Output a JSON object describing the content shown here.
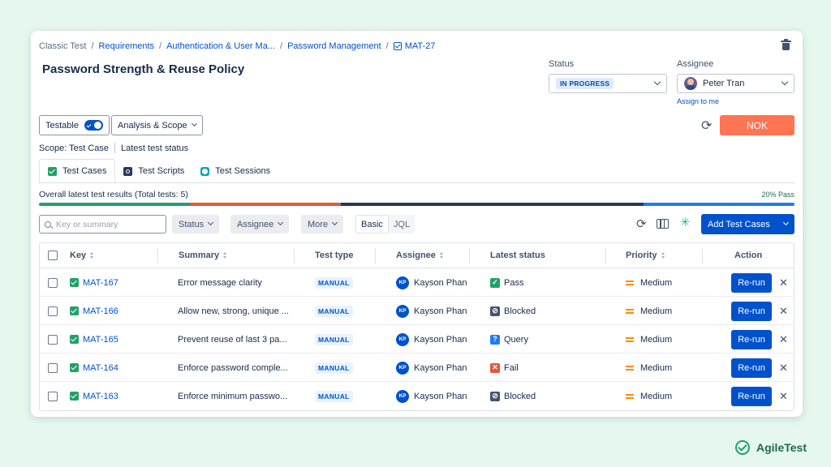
{
  "breadcrumb": {
    "items": [
      "Classic Test",
      "Requirements",
      "Authentication & User Ma...",
      "Password Management",
      "MAT-27"
    ],
    "separator": "/"
  },
  "page": {
    "title": "Password Strength & Reuse Policy"
  },
  "status": {
    "label": "Status",
    "value": "IN PROGRESS"
  },
  "assignee": {
    "label": "Assignee",
    "value": "Peter Tran",
    "assign_to_me": "Assign to me"
  },
  "toolbar": {
    "testable_label": "Testable",
    "testable_on": true,
    "analysis_label": "Analysis & Scope",
    "nok_label": "NOK"
  },
  "scope": {
    "text": "Scope: Test Case",
    "latest": "Latest test status"
  },
  "tabs": [
    {
      "label": "Test Cases",
      "icon": "test-cases-icon",
      "active": true
    },
    {
      "label": "Test Scripts",
      "icon": "test-scripts-icon",
      "active": false
    },
    {
      "label": "Test Sessions",
      "icon": "test-sessions-icon",
      "active": false
    }
  ],
  "results": {
    "summary": "Overall latest test results (Total tests: 5)",
    "pass_text": "20% Pass",
    "segments": [
      {
        "status": "pass",
        "fraction": 0.2,
        "color": "#22a06b"
      },
      {
        "status": "fail",
        "fraction": 0.2,
        "color": "#e2583e"
      },
      {
        "status": "blocked",
        "fraction": 0.4,
        "color": "#253858"
      },
      {
        "status": "query",
        "fraction": 0.2,
        "color": "#1d7afc"
      }
    ]
  },
  "filters": {
    "search_placeholder": "Key or summary",
    "status": "Status",
    "assignee": "Assignee",
    "more": "More",
    "basic": "Basic",
    "jql": "JQL",
    "add_button": "Add Test Cases"
  },
  "table": {
    "headers": {
      "key": "Key",
      "summary": "Summary",
      "test_type": "Test type",
      "assignee": "Assignee",
      "latest_status": "Latest status",
      "priority": "Priority",
      "action": "Action"
    },
    "rows": [
      {
        "key": "MAT-167",
        "summary": "Error message clarity",
        "type": "MANUAL",
        "initials": "KP",
        "assignee": "Kayson Phan",
        "status": "Pass",
        "status_icon": "pass-icon",
        "priority": "Medium",
        "action": "Re-run"
      },
      {
        "key": "MAT-166",
        "summary": "Allow new, strong, unique ...",
        "type": "MANUAL",
        "initials": "KP",
        "assignee": "Kayson Phan",
        "status": "Blocked",
        "status_icon": "blocked-icon",
        "priority": "Medium",
        "action": "Re-run"
      },
      {
        "key": "MAT-165",
        "summary": "Prevent reuse of last 3 pa...",
        "type": "MANUAL",
        "initials": "KP",
        "assignee": "Kayson Phan",
        "status": "Query",
        "status_icon": "query-icon",
        "priority": "Medium",
        "action": "Re-run"
      },
      {
        "key": "MAT-164",
        "summary": "Enforce password comple...",
        "type": "MANUAL",
        "initials": "KP",
        "assignee": "Kayson Phan",
        "status": "Fail",
        "status_icon": "fail-icon",
        "priority": "Medium",
        "action": "Re-run"
      },
      {
        "key": "MAT-163",
        "summary": "Enforce minimum passwo...",
        "type": "MANUAL",
        "initials": "KP",
        "assignee": "Kayson Phan",
        "status": "Blocked",
        "status_icon": "blocked-icon",
        "priority": "Medium",
        "action": "Re-run"
      }
    ]
  },
  "brand": {
    "name": "AgileTest"
  }
}
